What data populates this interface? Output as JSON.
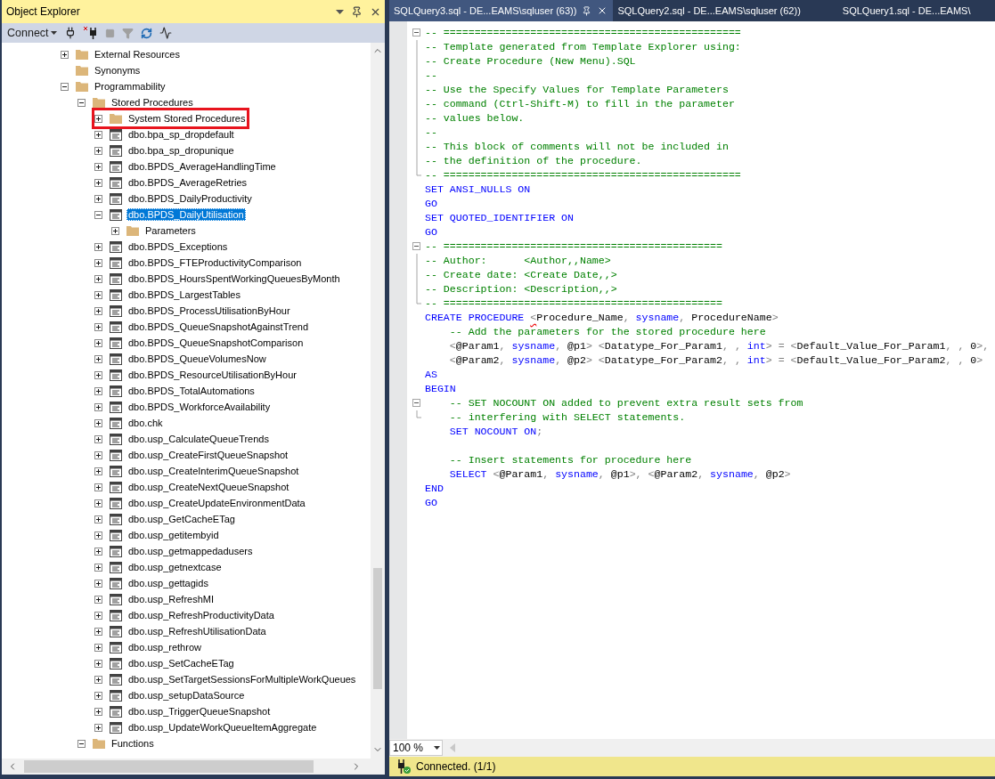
{
  "object_explorer": {
    "title": "Object Explorer",
    "toolbar": {
      "connect_label": "Connect"
    },
    "tree": [
      {
        "label": "External Resources",
        "kind": "folder",
        "expandable": true,
        "expanded": false,
        "selected": false,
        "highlighted": false
      },
      {
        "label": "Synonyms",
        "kind": "folder",
        "expandable": false,
        "selected": false,
        "highlighted": false
      },
      {
        "label": "Programmability",
        "kind": "folder",
        "expandable": true,
        "expanded": true,
        "selected": false,
        "highlighted": false,
        "children": [
          {
            "label": "Stored Procedures",
            "kind": "folder",
            "expandable": true,
            "expanded": true,
            "selected": false,
            "highlighted": false,
            "children": [
              {
                "label": "System Stored Procedures",
                "kind": "folder",
                "expandable": true,
                "expanded": false,
                "selected": false,
                "highlighted": true
              },
              {
                "label": "dbo.bpa_sp_dropdefault",
                "kind": "procedure",
                "expandable": true,
                "expanded": false,
                "selected": false,
                "highlighted": false
              },
              {
                "label": "dbo.bpa_sp_dropunique",
                "kind": "procedure",
                "expandable": true,
                "expanded": false,
                "selected": false,
                "highlighted": false
              },
              {
                "label": "dbo.BPDS_AverageHandlingTime",
                "kind": "procedure",
                "expandable": true,
                "expanded": false,
                "selected": false,
                "highlighted": false
              },
              {
                "label": "dbo.BPDS_AverageRetries",
                "kind": "procedure",
                "expandable": true,
                "expanded": false,
                "selected": false,
                "highlighted": false
              },
              {
                "label": "dbo.BPDS_DailyProductivity",
                "kind": "procedure",
                "expandable": true,
                "expanded": false,
                "selected": false,
                "highlighted": false
              },
              {
                "label": "dbo.BPDS_DailyUtilisation",
                "kind": "procedure",
                "expandable": true,
                "expanded": true,
                "selected": true,
                "highlighted": false,
                "children": [
                  {
                    "label": "Parameters",
                    "kind": "folder",
                    "expandable": true,
                    "expanded": false,
                    "selected": false,
                    "highlighted": false
                  }
                ]
              },
              {
                "label": "dbo.BPDS_Exceptions",
                "kind": "procedure",
                "expandable": true,
                "expanded": false,
                "selected": false,
                "highlighted": false
              },
              {
                "label": "dbo.BPDS_FTEProductivityComparison",
                "kind": "procedure",
                "expandable": true,
                "expanded": false,
                "selected": false,
                "highlighted": false
              },
              {
                "label": "dbo.BPDS_HoursSpentWorkingQueuesByMonth",
                "kind": "procedure",
                "expandable": true,
                "expanded": false,
                "selected": false,
                "highlighted": false
              },
              {
                "label": "dbo.BPDS_LargestTables",
                "kind": "procedure",
                "expandable": true,
                "expanded": false,
                "selected": false,
                "highlighted": false
              },
              {
                "label": "dbo.BPDS_ProcessUtilisationByHour",
                "kind": "procedure",
                "expandable": true,
                "expanded": false,
                "selected": false,
                "highlighted": false
              },
              {
                "label": "dbo.BPDS_QueueSnapshotAgainstTrend",
                "kind": "procedure",
                "expandable": true,
                "expanded": false,
                "selected": false,
                "highlighted": false
              },
              {
                "label": "dbo.BPDS_QueueSnapshotComparison",
                "kind": "procedure",
                "expandable": true,
                "expanded": false,
                "selected": false,
                "highlighted": false
              },
              {
                "label": "dbo.BPDS_QueueVolumesNow",
                "kind": "procedure",
                "expandable": true,
                "expanded": false,
                "selected": false,
                "highlighted": false
              },
              {
                "label": "dbo.BPDS_ResourceUtilisationByHour",
                "kind": "procedure",
                "expandable": true,
                "expanded": false,
                "selected": false,
                "highlighted": false
              },
              {
                "label": "dbo.BPDS_TotalAutomations",
                "kind": "procedure",
                "expandable": true,
                "expanded": false,
                "selected": false,
                "highlighted": false
              },
              {
                "label": "dbo.BPDS_WorkforceAvailability",
                "kind": "procedure",
                "expandable": true,
                "expanded": false,
                "selected": false,
                "highlighted": false
              },
              {
                "label": "dbo.chk",
                "kind": "procedure",
                "expandable": true,
                "expanded": false,
                "selected": false,
                "highlighted": false
              },
              {
                "label": "dbo.usp_CalculateQueueTrends",
                "kind": "procedure",
                "expandable": true,
                "expanded": false,
                "selected": false,
                "highlighted": false
              },
              {
                "label": "dbo.usp_CreateFirstQueueSnapshot",
                "kind": "procedure",
                "expandable": true,
                "expanded": false,
                "selected": false,
                "highlighted": false
              },
              {
                "label": "dbo.usp_CreateInterimQueueSnapshot",
                "kind": "procedure",
                "expandable": true,
                "expanded": false,
                "selected": false,
                "highlighted": false
              },
              {
                "label": "dbo.usp_CreateNextQueueSnapshot",
                "kind": "procedure",
                "expandable": true,
                "expanded": false,
                "selected": false,
                "highlighted": false
              },
              {
                "label": "dbo.usp_CreateUpdateEnvironmentData",
                "kind": "procedure",
                "expandable": true,
                "expanded": false,
                "selected": false,
                "highlighted": false
              },
              {
                "label": "dbo.usp_GetCacheETag",
                "kind": "procedure",
                "expandable": true,
                "expanded": false,
                "selected": false,
                "highlighted": false
              },
              {
                "label": "dbo.usp_getitembyid",
                "kind": "procedure",
                "expandable": true,
                "expanded": false,
                "selected": false,
                "highlighted": false
              },
              {
                "label": "dbo.usp_getmappedadusers",
                "kind": "procedure",
                "expandable": true,
                "expanded": false,
                "selected": false,
                "highlighted": false
              },
              {
                "label": "dbo.usp_getnextcase",
                "kind": "procedure",
                "expandable": true,
                "expanded": false,
                "selected": false,
                "highlighted": false
              },
              {
                "label": "dbo.usp_gettagids",
                "kind": "procedure",
                "expandable": true,
                "expanded": false,
                "selected": false,
                "highlighted": false
              },
              {
                "label": "dbo.usp_RefreshMI",
                "kind": "procedure",
                "expandable": true,
                "expanded": false,
                "selected": false,
                "highlighted": false
              },
              {
                "label": "dbo.usp_RefreshProductivityData",
                "kind": "procedure",
                "expandable": true,
                "expanded": false,
                "selected": false,
                "highlighted": false
              },
              {
                "label": "dbo.usp_RefreshUtilisationData",
                "kind": "procedure",
                "expandable": true,
                "expanded": false,
                "selected": false,
                "highlighted": false
              },
              {
                "label": "dbo.usp_rethrow",
                "kind": "procedure",
                "expandable": true,
                "expanded": false,
                "selected": false,
                "highlighted": false
              },
              {
                "label": "dbo.usp_SetCacheETag",
                "kind": "procedure",
                "expandable": true,
                "expanded": false,
                "selected": false,
                "highlighted": false
              },
              {
                "label": "dbo.usp_SetTargetSessionsForMultipleWorkQueues",
                "kind": "procedure",
                "expandable": true,
                "expanded": false,
                "selected": false,
                "highlighted": false
              },
              {
                "label": "dbo.usp_setupDataSource",
                "kind": "procedure",
                "expandable": true,
                "expanded": false,
                "selected": false,
                "highlighted": false
              },
              {
                "label": "dbo.usp_TriggerQueueSnapshot",
                "kind": "procedure",
                "expandable": true,
                "expanded": false,
                "selected": false,
                "highlighted": false
              },
              {
                "label": "dbo.usp_UpdateWorkQueueItemAggregate",
                "kind": "procedure",
                "expandable": true,
                "expanded": false,
                "selected": false,
                "highlighted": false
              }
            ]
          },
          {
            "label": "Functions",
            "kind": "folder",
            "expandable": true,
            "expanded": true,
            "selected": false,
            "highlighted": false
          }
        ]
      }
    ]
  },
  "editor": {
    "tabs": [
      {
        "label": "SQLQuery3.sql - DE...EAMS\\sqluser (63))",
        "selected": true
      },
      {
        "label": "SQLQuery2.sql - DE...EAMS\\sqluser (62))",
        "selected": false
      },
      {
        "label": "SQLQuery1.sql - DE...EAMS\\",
        "selected": false
      }
    ],
    "lines": [
      {
        "kind": "fold",
        "expanded": true,
        "lines": [
          {
            "tokens": [
              {
                "kind": "comment",
                "text": "-- ================================================"
              }
            ]
          },
          {
            "tokens": [
              {
                "kind": "comment",
                "text": "-- Template generated from Template Explorer using:"
              }
            ]
          },
          {
            "tokens": [
              {
                "kind": "comment",
                "text": "-- Create Procedure (New Menu).SQL"
              }
            ]
          },
          {
            "tokens": [
              {
                "kind": "comment",
                "text": "--"
              }
            ]
          },
          {
            "tokens": [
              {
                "kind": "comment",
                "text": "-- Use the Specify Values for Template Parameters"
              }
            ]
          },
          {
            "tokens": [
              {
                "kind": "comment",
                "text": "-- command (Ctrl-Shift-M) to fill in the parameter"
              }
            ]
          },
          {
            "tokens": [
              {
                "kind": "comment",
                "text": "-- values below."
              }
            ]
          },
          {
            "tokens": [
              {
                "kind": "comment",
                "text": "--"
              }
            ]
          },
          {
            "tokens": [
              {
                "kind": "comment",
                "text": "-- This block of comments will not be included in"
              }
            ]
          },
          {
            "tokens": [
              {
                "kind": "comment",
                "text": "-- the definition of the procedure."
              }
            ]
          },
          {
            "tokens": [
              {
                "kind": "comment",
                "text": "-- ================================================"
              }
            ]
          }
        ]
      },
      {
        "kind": "line",
        "tokens": [
          {
            "kind": "keyword",
            "text": "SET ANSI_NULLS ON"
          }
        ]
      },
      {
        "kind": "line",
        "tokens": [
          {
            "kind": "keyword",
            "text": "GO"
          }
        ]
      },
      {
        "kind": "line",
        "tokens": [
          {
            "kind": "keyword",
            "text": "SET QUOTED_IDENTIFIER ON"
          }
        ]
      },
      {
        "kind": "line",
        "tokens": [
          {
            "kind": "keyword",
            "text": "GO"
          }
        ]
      },
      {
        "kind": "fold",
        "expanded": true,
        "lines": [
          {
            "tokens": [
              {
                "kind": "comment",
                "text": "-- ============================================="
              }
            ]
          },
          {
            "tokens": [
              {
                "kind": "comment",
                "text": "-- Author:      <Author,,Name>"
              }
            ]
          },
          {
            "tokens": [
              {
                "kind": "comment",
                "text": "-- Create date: <Create Date,,>"
              }
            ]
          },
          {
            "tokens": [
              {
                "kind": "comment",
                "text": "-- Description: <Description,,>"
              }
            ]
          },
          {
            "tokens": [
              {
                "kind": "comment",
                "text": "-- ============================================="
              }
            ]
          }
        ]
      },
      {
        "kind": "line",
        "tokens": [
          {
            "kind": "keyword",
            "text": "CREATE PROCEDURE "
          },
          {
            "kind": "error",
            "text": "<"
          },
          {
            "kind": "plain",
            "text": "Procedure_Name"
          },
          {
            "kind": "operator",
            "text": ", "
          },
          {
            "kind": "keyword",
            "text": "sysname"
          },
          {
            "kind": "operator",
            "text": ", "
          },
          {
            "kind": "plain",
            "text": "ProcedureName"
          },
          {
            "kind": "operator",
            "text": ">"
          }
        ]
      },
      {
        "kind": "line",
        "tokens": [
          {
            "kind": "comment",
            "text": "    -- Add the parameters for the stored procedure here"
          }
        ]
      },
      {
        "kind": "line",
        "tokens": [
          {
            "kind": "operator",
            "text": "    <"
          },
          {
            "kind": "plain",
            "text": "@Param1"
          },
          {
            "kind": "operator",
            "text": ", "
          },
          {
            "kind": "keyword",
            "text": "sysname"
          },
          {
            "kind": "operator",
            "text": ", "
          },
          {
            "kind": "plain",
            "text": "@p1"
          },
          {
            "kind": "operator",
            "text": "> <"
          },
          {
            "kind": "plain",
            "text": "Datatype_For_Param1"
          },
          {
            "kind": "operator",
            "text": ", , "
          },
          {
            "kind": "keyword",
            "text": "int"
          },
          {
            "kind": "operator",
            "text": "> = <"
          },
          {
            "kind": "plain",
            "text": "Default_Value_For_Param1"
          },
          {
            "kind": "operator",
            "text": ", , "
          },
          {
            "kind": "plain",
            "text": "0"
          },
          {
            "kind": "operator",
            "text": ">,"
          }
        ]
      },
      {
        "kind": "line",
        "tokens": [
          {
            "kind": "operator",
            "text": "    <"
          },
          {
            "kind": "plain",
            "text": "@Param2"
          },
          {
            "kind": "operator",
            "text": ", "
          },
          {
            "kind": "keyword",
            "text": "sysname"
          },
          {
            "kind": "operator",
            "text": ", "
          },
          {
            "kind": "plain",
            "text": "@p2"
          },
          {
            "kind": "operator",
            "text": "> <"
          },
          {
            "kind": "plain",
            "text": "Datatype_For_Param2"
          },
          {
            "kind": "operator",
            "text": ", , "
          },
          {
            "kind": "keyword",
            "text": "int"
          },
          {
            "kind": "operator",
            "text": "> = <"
          },
          {
            "kind": "plain",
            "text": "Default_Value_For_Param2"
          },
          {
            "kind": "operator",
            "text": ", , "
          },
          {
            "kind": "plain",
            "text": "0"
          },
          {
            "kind": "operator",
            "text": ">"
          }
        ]
      },
      {
        "kind": "line",
        "tokens": [
          {
            "kind": "keyword",
            "text": "AS"
          }
        ]
      },
      {
        "kind": "line",
        "tokens": [
          {
            "kind": "keyword",
            "text": "BEGIN"
          }
        ]
      },
      {
        "kind": "fold",
        "expanded": true,
        "lines": [
          {
            "tokens": [
              {
                "kind": "comment",
                "text": "    -- SET NOCOUNT ON added to prevent extra result sets from"
              }
            ]
          },
          {
            "tokens": [
              {
                "kind": "comment",
                "text": "    -- interfering with SELECT statements."
              }
            ]
          }
        ]
      },
      {
        "kind": "line",
        "tokens": [
          {
            "kind": "keyword",
            "text": "    SET NOCOUNT ON"
          },
          {
            "kind": "operator",
            "text": ";"
          }
        ]
      },
      {
        "kind": "line"
      },
      {
        "kind": "line",
        "tokens": [
          {
            "kind": "comment",
            "text": "    -- Insert statements for procedure here"
          }
        ]
      },
      {
        "kind": "line",
        "tokens": [
          {
            "kind": "keyword",
            "text": "    SELECT "
          },
          {
            "kind": "operator",
            "text": "<"
          },
          {
            "kind": "plain",
            "text": "@Param1"
          },
          {
            "kind": "operator",
            "text": ", "
          },
          {
            "kind": "keyword",
            "text": "sysname"
          },
          {
            "kind": "operator",
            "text": ", "
          },
          {
            "kind": "plain",
            "text": "@p1"
          },
          {
            "kind": "operator",
            "text": ">, <"
          },
          {
            "kind": "plain",
            "text": "@Param2"
          },
          {
            "kind": "operator",
            "text": ", "
          },
          {
            "kind": "keyword",
            "text": "sysname"
          },
          {
            "kind": "operator",
            "text": ", "
          },
          {
            "kind": "plain",
            "text": "@p2"
          },
          {
            "kind": "operator",
            "text": ">"
          }
        ]
      },
      {
        "kind": "line",
        "tokens": [
          {
            "kind": "keyword",
            "text": "END"
          }
        ]
      },
      {
        "kind": "line",
        "tokens": [
          {
            "kind": "keyword",
            "text": "GO"
          }
        ]
      }
    ],
    "zoom": {
      "value": "100 %"
    }
  },
  "status_bar": {
    "text": "Connected. (1/1)"
  }
}
